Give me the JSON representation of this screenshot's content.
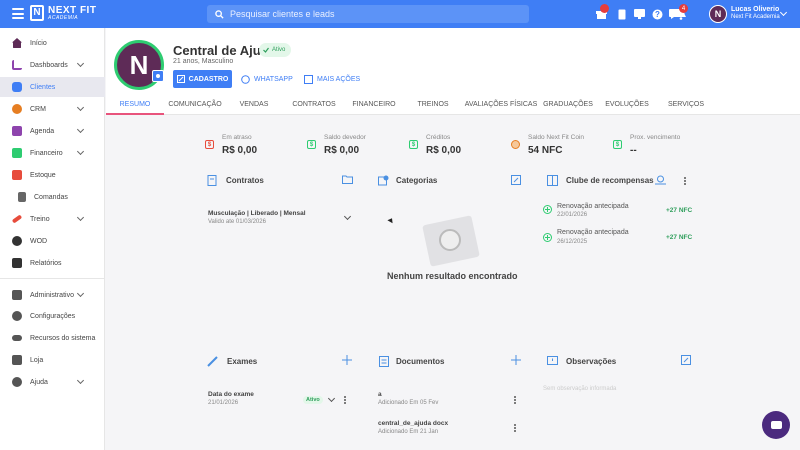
{
  "topbar": {
    "brand_line1": "NEXT FIT",
    "brand_line2": "ACADEMIA",
    "search_placeholder": "Pesquisar clientes e leads",
    "notifications_count": "4",
    "user_name": "Lucas Oliverio",
    "user_org": "Next Fit Academia"
  },
  "sidebar": {
    "items": [
      {
        "label": "Início",
        "icon": "home-icon",
        "color": "#5e2b57"
      },
      {
        "label": "Dashboards",
        "icon": "chart-icon",
        "color": "#8e44ad"
      },
      {
        "label": "Clientes",
        "icon": "clients-icon",
        "color": "#3f7ef5"
      },
      {
        "label": "CRM",
        "icon": "crm-icon",
        "color": "#e67e22"
      },
      {
        "label": "Agenda",
        "icon": "calendar-icon",
        "color": "#8e44ad"
      },
      {
        "label": "Financeiro",
        "icon": "money-icon",
        "color": "#2ecc71"
      },
      {
        "label": "Estoque",
        "icon": "cart-icon",
        "color": "#e74c3c"
      },
      {
        "label": "Comandas",
        "icon": "receipt-icon",
        "color": "#555555"
      },
      {
        "label": "Treino",
        "icon": "dumbbell-icon",
        "color": "#e74c3c"
      },
      {
        "label": "WOD",
        "icon": "kettlebell-icon",
        "color": "#333333"
      },
      {
        "label": "Relatórios",
        "icon": "report-icon",
        "color": "#333333"
      },
      {
        "label": "Administrativo",
        "icon": "admin-icon",
        "color": "#555555"
      },
      {
        "label": "Configurações",
        "icon": "gear-icon",
        "color": "#555555"
      },
      {
        "label": "Recursos do sistema",
        "icon": "toggle-icon",
        "color": "#555555"
      },
      {
        "label": "Loja",
        "icon": "store-icon",
        "color": "#555555"
      },
      {
        "label": "Ajuda",
        "icon": "help-icon",
        "color": "#555555"
      }
    ]
  },
  "profile": {
    "name": "Central de Ajuda",
    "status": "Ativo",
    "subtitle": "21 anos, Masculino",
    "btn_cadastro": "CADASTRO",
    "btn_whatsapp": "WHATSAPP",
    "btn_more": "MAIS AÇÕES"
  },
  "tabs": [
    "RESUMO",
    "COMUNICAÇÃO",
    "VENDAS",
    "CONTRATOS",
    "FINANCEIRO",
    "TREINOS",
    "AVALIAÇÕES FÍSICAS",
    "GRADUAÇÕES",
    "EVOLUÇÕES",
    "SERVIÇOS"
  ],
  "metrics": [
    {
      "label": "Em atraso",
      "value": "R$ 0,00",
      "color": "#e74c3c"
    },
    {
      "label": "Saldo devedor",
      "value": "R$ 0,00",
      "color": "#2ecc71"
    },
    {
      "label": "Créditos",
      "value": "R$ 0,00",
      "color": "#2ecc71"
    },
    {
      "label": "Saldo Next Fit Coin",
      "value": "54 NFC",
      "color": "#e67e22"
    },
    {
      "label": "Prox. vencimento",
      "value": "--",
      "color": "#2ecc71"
    }
  ],
  "contratos": {
    "title": "Contratos",
    "plan": "Musculação | Liberado | Mensal",
    "valid": "Valido ate 01/03/2026"
  },
  "categorias": {
    "title": "Categorias",
    "empty": "Nenhum resultado encontrado"
  },
  "clube": {
    "title": "Clube de recompensas",
    "items": [
      {
        "label": "Renovação antecipada",
        "date": "22/01/2026",
        "points": "+27 NFC"
      },
      {
        "label": "Renovação antecipada",
        "date": "26/12/2025",
        "points": "+27 NFC"
      }
    ]
  },
  "exames": {
    "title": "Exames",
    "label": "Data do exame",
    "date": "21/01/2026",
    "status": "Ativo"
  },
  "documentos": {
    "title": "Documentos",
    "items": [
      {
        "name": "a",
        "sub": "Adicionado Em 05 Fev"
      },
      {
        "name": "central_de_ajuda docx",
        "sub": "Adicionado Em 21 Jan"
      }
    ]
  },
  "observacoes": {
    "title": "Observações",
    "empty": "Sem observação informada"
  }
}
